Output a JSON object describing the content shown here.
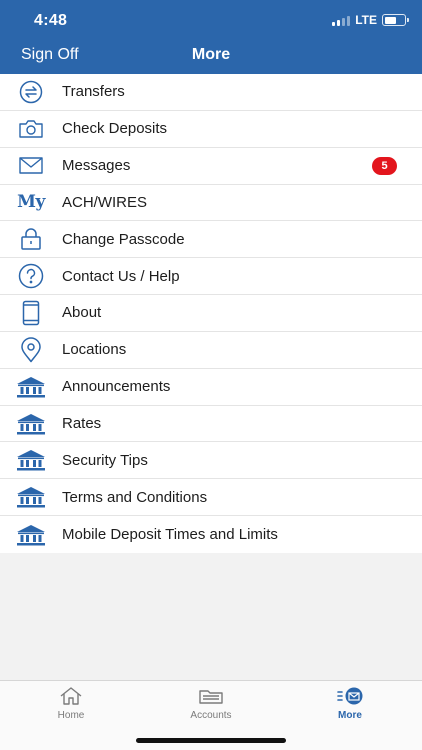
{
  "status": {
    "time": "4:48",
    "network": "LTE"
  },
  "nav": {
    "left": "Sign Off",
    "title": "More"
  },
  "menu": [
    {
      "label": "Transfers",
      "icon": "transfer-icon"
    },
    {
      "label": "Check Deposits",
      "icon": "camera-icon"
    },
    {
      "label": "Messages",
      "icon": "envelope-icon",
      "badge": "5"
    },
    {
      "label": "ACH/WIRES",
      "icon": "my-icon",
      "icon_text": "My"
    },
    {
      "label": "Change Passcode",
      "icon": "lock-icon"
    },
    {
      "label": "Contact Us / Help",
      "icon": "help-icon"
    },
    {
      "label": "About",
      "icon": "phone-icon"
    },
    {
      "label": "Locations",
      "icon": "location-pin-icon"
    },
    {
      "label": "Announcements",
      "icon": "bank-icon"
    },
    {
      "label": "Rates",
      "icon": "bank-icon"
    },
    {
      "label": "Security Tips",
      "icon": "bank-icon"
    },
    {
      "label": "Terms and Conditions",
      "icon": "bank-icon"
    },
    {
      "label": "Mobile Deposit Times and Limits",
      "icon": "bank-icon"
    }
  ],
  "tabs": [
    {
      "label": "Home",
      "icon": "home-icon",
      "active": false
    },
    {
      "label": "Accounts",
      "icon": "wallet-icon",
      "active": false
    },
    {
      "label": "More",
      "icon": "more-envelope-icon",
      "active": true
    }
  ],
  "colors": {
    "brand": "#2b66ab",
    "badge": "#e3151d",
    "background": "#f2f2f2"
  }
}
